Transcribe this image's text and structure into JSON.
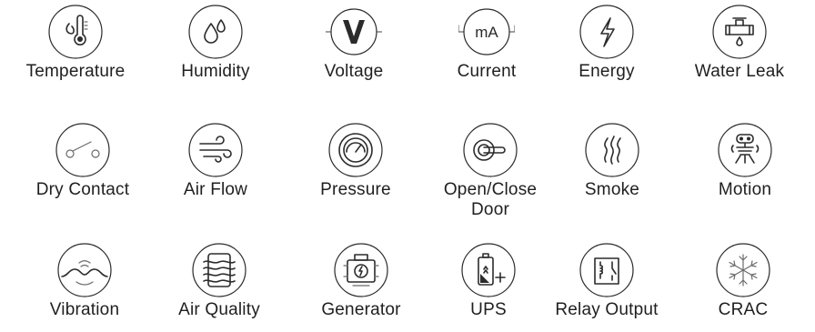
{
  "items": [
    {
      "label": "Temperature",
      "icon": "thermometer-icon"
    },
    {
      "label": "Humidity",
      "icon": "water-drops-icon"
    },
    {
      "label": "Voltage",
      "icon": "voltage-icon"
    },
    {
      "label": "Current",
      "icon": "current-ma-icon",
      "icon_text": "mA"
    },
    {
      "label": "Energy",
      "icon": "lightning-bolt-icon"
    },
    {
      "label": "Water Leak",
      "icon": "dripping-pipe-icon"
    },
    {
      "label": "Dry Contact",
      "icon": "open-switch-icon"
    },
    {
      "label": "Air Flow",
      "icon": "wind-icon"
    },
    {
      "label": "Pressure",
      "icon": "pressure-gauge-icon"
    },
    {
      "label": "Open/Close Door",
      "icon": "door-handle-icon"
    },
    {
      "label": "Smoke",
      "icon": "smoke-icon"
    },
    {
      "label": "Motion",
      "icon": "motion-sensor-icon"
    },
    {
      "label": "Vibration",
      "icon": "vibration-icon"
    },
    {
      "label": "Air Quality",
      "icon": "air-filter-icon"
    },
    {
      "label": "Generator",
      "icon": "generator-icon"
    },
    {
      "label": "UPS",
      "icon": "battery-ups-icon"
    },
    {
      "label": "Relay Output",
      "icon": "relay-icon"
    },
    {
      "label": "CRAC",
      "icon": "snowflake-icon"
    }
  ]
}
